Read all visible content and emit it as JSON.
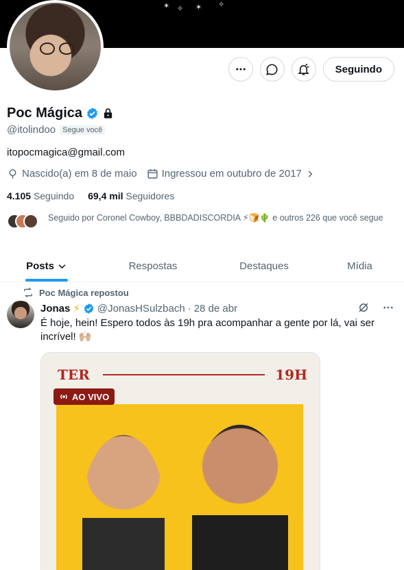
{
  "profile": {
    "name": "Poc Mágica",
    "handle": "@itolindoo",
    "follows_you": "Segue você",
    "bio": "itopocmagica@gmail.com",
    "birthday": "Nascido(a) em 8 de maio",
    "joined": "Ingressou em outubro de 2017",
    "following_count": "4.105",
    "following_label": "Seguindo",
    "followers_count": "69,4 mil",
    "followers_label": "Seguidores",
    "followed_by": "Seguido por Coronel Cowboy, BBBDADISCORDIA ⚡🍞🌵 e outros 226 que você segue",
    "follow_button": "Seguindo"
  },
  "icons": {
    "more": "more-icon",
    "message": "message-icon",
    "notifications": "bell-icon",
    "verified": "verified-icon",
    "lock": "lock-icon",
    "location": "location-icon",
    "calendar": "calendar-icon",
    "repost": "repost-icon",
    "grok": "grok-icon"
  },
  "colors": {
    "accent": "#1d9bf0",
    "text": "#0f1419",
    "muted": "#536471"
  },
  "tabs": [
    {
      "label": "Posts",
      "active": true
    },
    {
      "label": "Respostas"
    },
    {
      "label": "Destaques"
    },
    {
      "label": "Mídia"
    }
  ],
  "post": {
    "repost_label": "Poc Mágica repostou",
    "author_name": "Jonas",
    "author_emoji": "⚡",
    "author_handle": "@JonasHSulzbach",
    "date": "28 de abr",
    "text": "É hoje, hein! Espero todos às 19h pra acompanhar a gente por lá, vai ser incrível! 🙌🏼",
    "media": {
      "day": "TER",
      "time": "19H",
      "live": "AO VIVO"
    }
  }
}
